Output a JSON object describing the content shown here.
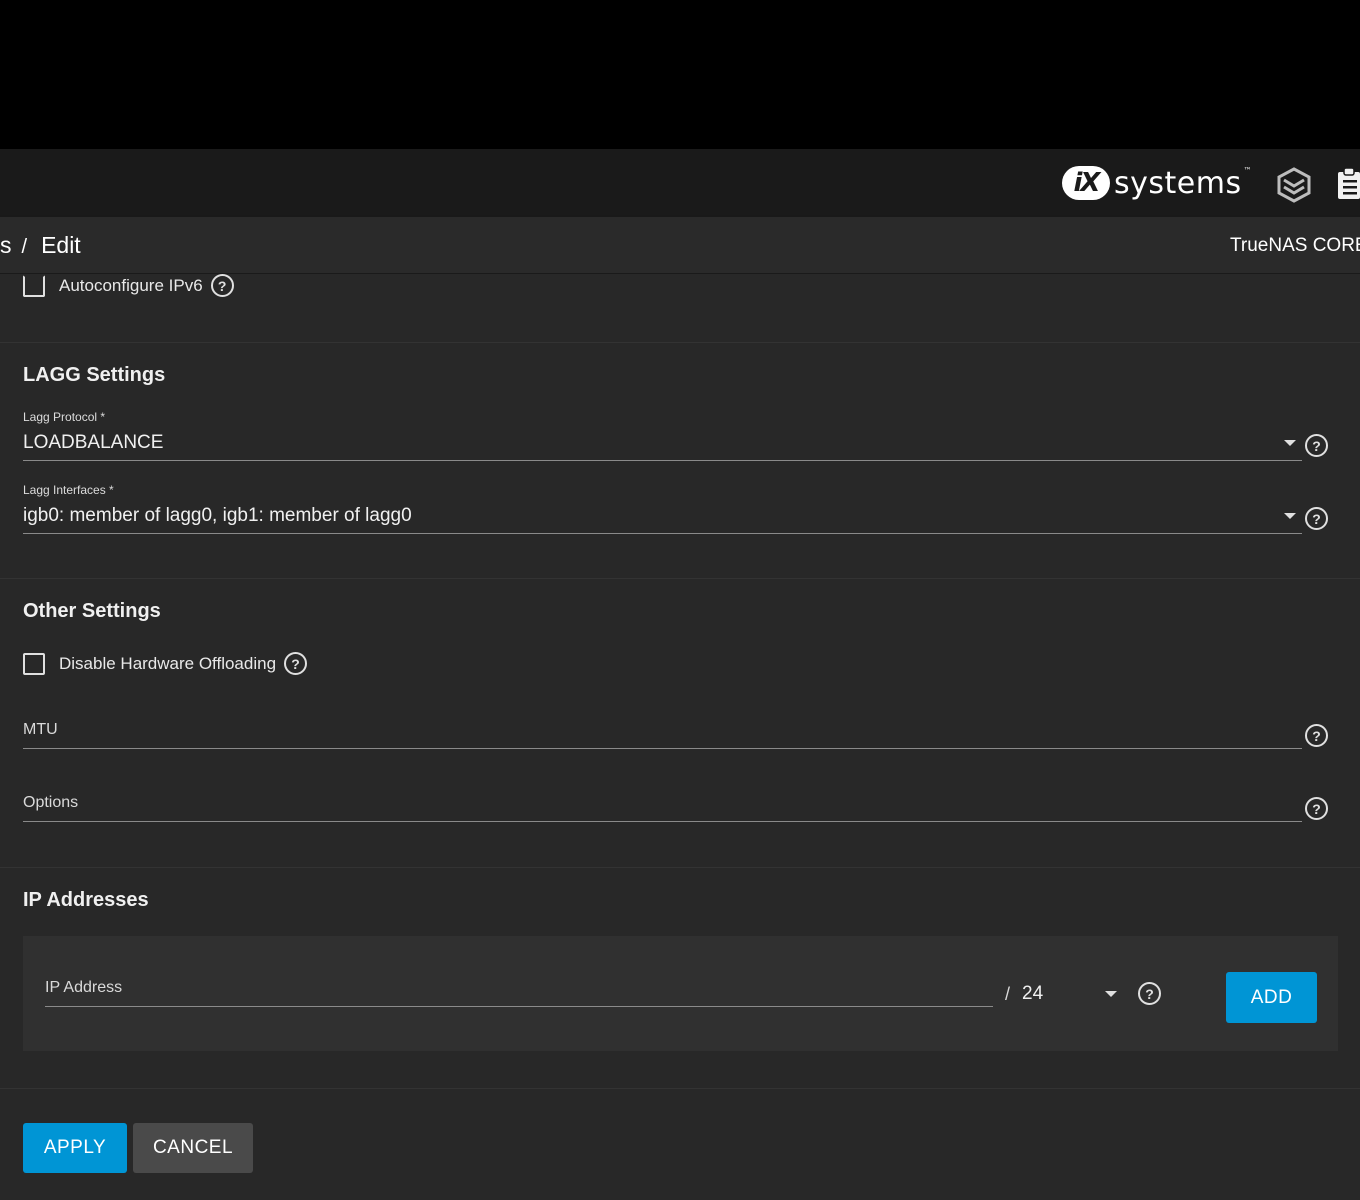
{
  "header": {
    "logo_mark": "iX",
    "logo_text": "systems",
    "logo_tm": "™",
    "icons": [
      "truecommand-icon",
      "clipboard-icon"
    ]
  },
  "breadcrumb": {
    "parent": "s",
    "separator": "/",
    "current": "Edit"
  },
  "product_name": "TrueNAS CORE",
  "autoconfigure": {
    "label": "Autoconfigure IPv6",
    "checked": false
  },
  "lagg": {
    "title": "LAGG Settings",
    "protocol_label": "Lagg Protocol *",
    "protocol_value": "LOADBALANCE",
    "interfaces_label": "Lagg Interfaces *",
    "interfaces_value": "igb0: member of lagg0, igb1: member of lagg0"
  },
  "other": {
    "title": "Other Settings",
    "disable_offload_label": "Disable Hardware Offloading",
    "disable_offload_checked": false,
    "mtu_placeholder": "MTU",
    "options_placeholder": "Options"
  },
  "ip": {
    "title": "IP Addresses",
    "address_placeholder": "IP Address",
    "slash": "/",
    "netmask": "24",
    "add_label": "ADD"
  },
  "actions": {
    "apply_label": "APPLY",
    "cancel_label": "CANCEL"
  },
  "colors": {
    "primary": "#0095d5",
    "background": "#282828",
    "topbar": "#1a1a1a"
  }
}
